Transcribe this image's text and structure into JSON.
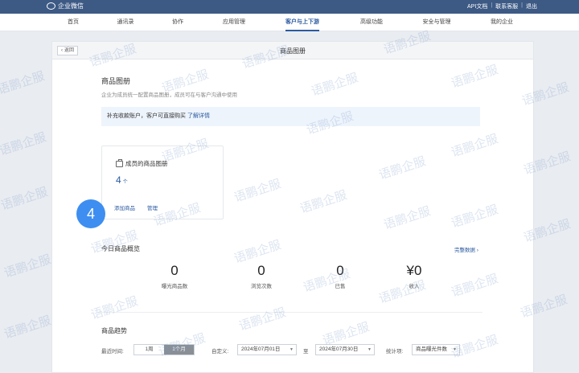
{
  "topbar": {
    "app_name": "企业微信",
    "links": [
      "API文档",
      "联系客服",
      "退出"
    ]
  },
  "nav": {
    "items": [
      "首页",
      "通讯录",
      "协作",
      "应用管理",
      "客户与上下游",
      "高级功能",
      "安全与管理",
      "我的企业"
    ],
    "active": "客户与上下游"
  },
  "page": {
    "back_label": "返回",
    "title": "商品图册"
  },
  "intro": {
    "title": "商品图册",
    "description": "企业为成员统一配置商品图册，成员可在与客户沟通中使用"
  },
  "notice": {
    "text": "补充收款账户，客户可直接购买",
    "link": "了解详情"
  },
  "album": {
    "title": "成员的商品图册",
    "count": "4",
    "unit": "个",
    "add_label": "添加商品",
    "manage_label": "管理"
  },
  "step_badge": "4",
  "overview": {
    "title": "今日商品概览",
    "more_link": "完整数据 ›",
    "stats": [
      {
        "value": "0",
        "label": "曝光商品数"
      },
      {
        "value": "0",
        "label": "浏览次数"
      },
      {
        "value": "0",
        "label": "已售"
      },
      {
        "value": "¥0",
        "label": "收入"
      }
    ]
  },
  "trend": {
    "title": "商品趋势",
    "time_label": "最近时间:",
    "range_options": [
      "1周",
      "1个月"
    ],
    "range_selected": "1个月",
    "custom_label": "自定义:",
    "start_date": "2024年07月01日",
    "to_label": "至",
    "end_date": "2024年07月30日",
    "metric_label": "统计项:",
    "metric_value": "商品曝光件数"
  },
  "watermark": "语鹏企服",
  "colors": {
    "topbar": "#3d5a85",
    "accent": "#2b5aa0",
    "badge": "#3d8ef0",
    "notice_bg": "#eef4fc"
  }
}
